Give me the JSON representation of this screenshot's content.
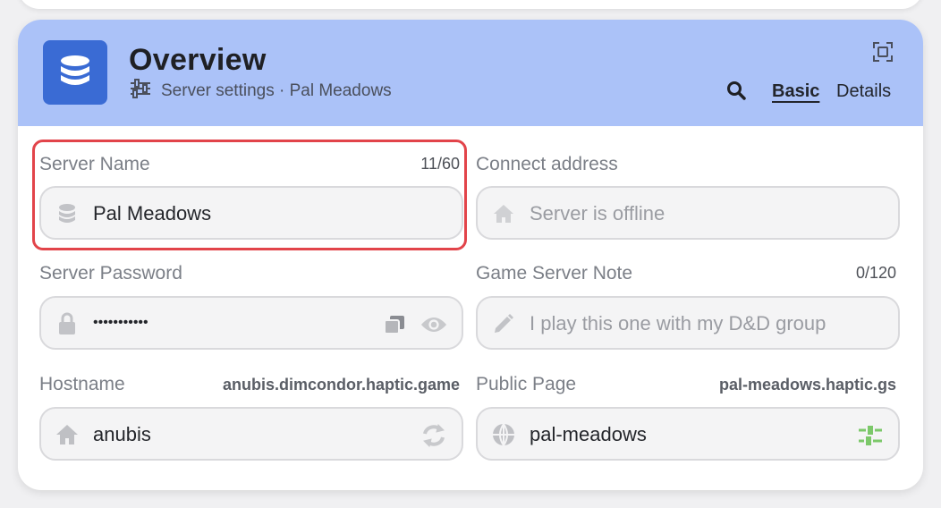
{
  "header": {
    "title": "Overview",
    "subtitle": "Server settings · Pal Meadows",
    "tabs": [
      {
        "label": "Basic",
        "active": true
      },
      {
        "label": "Details",
        "active": false
      }
    ],
    "accent_color": "#abc2f8",
    "icon_color": "#3a6bd4"
  },
  "fields": {
    "server_name": {
      "label": "Server Name",
      "counter": "11/60",
      "value": "Pal Meadows",
      "icon": "database-icon"
    },
    "connect_address": {
      "label": "Connect address",
      "placeholder": "Server is offline",
      "icon": "home-icon"
    },
    "server_password": {
      "label": "Server Password",
      "value": "•••••••••••",
      "icon": "lock-icon"
    },
    "game_server_note": {
      "label": "Game Server Note",
      "counter": "0/120",
      "placeholder": "I play this one with my D&D group",
      "icon": "pencil-icon"
    },
    "hostname": {
      "label": "Hostname",
      "domain": "anubis.dimcondor.haptic.game",
      "value": "anubis",
      "icon": "home-icon"
    },
    "public_page": {
      "label": "Public Page",
      "domain": "pal-meadows.haptic.gs",
      "value": "pal-meadows",
      "icon": "globe-icon"
    }
  },
  "highlight_color": "#e2444a"
}
